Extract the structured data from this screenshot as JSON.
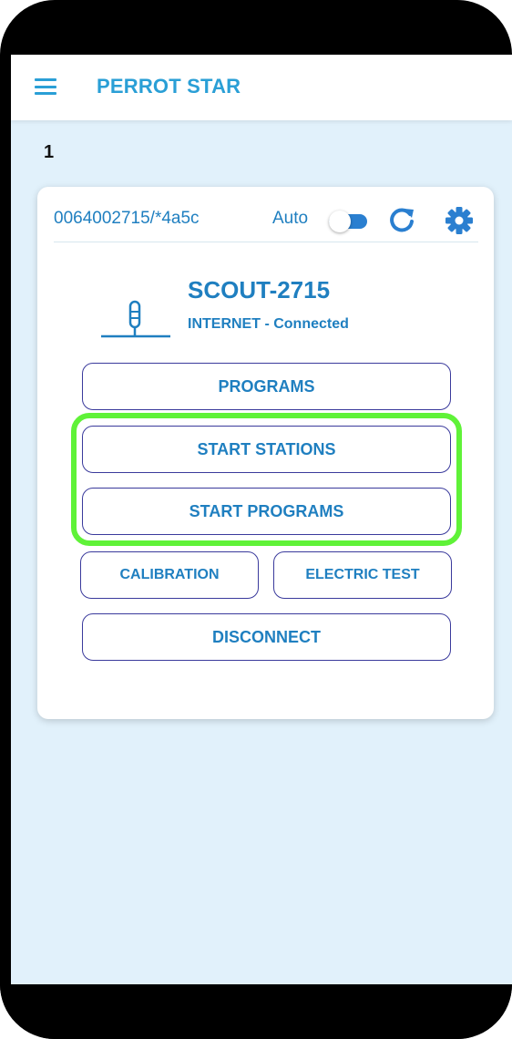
{
  "appbar": {
    "title": "PERROT STAR",
    "menu_icon": "hamburger-menu-icon"
  },
  "page": {
    "number": "1"
  },
  "device_card": {
    "device_id": "0064002715/*4a5c",
    "auto_label": "Auto",
    "auto_toggle": "on",
    "name": "SCOUT-2715",
    "status": "INTERNET - Connected",
    "icons": [
      "refresh-icon",
      "gear-icon",
      "sensor-device-icon"
    ]
  },
  "buttons": {
    "programs": "PROGRAMS",
    "start_stations": "START STATIONS",
    "start_programs": "START PROGRAMS",
    "calibration": "CALIBRATION",
    "electric_test": "ELECTRIC TEST",
    "disconnect": "DISCONNECT"
  },
  "colors": {
    "accent": "#2a9fd6",
    "text_blue": "#1f7fc0",
    "button_border": "#3a3a9c",
    "highlight": "#5ff238",
    "background": "#e1f1fb"
  }
}
